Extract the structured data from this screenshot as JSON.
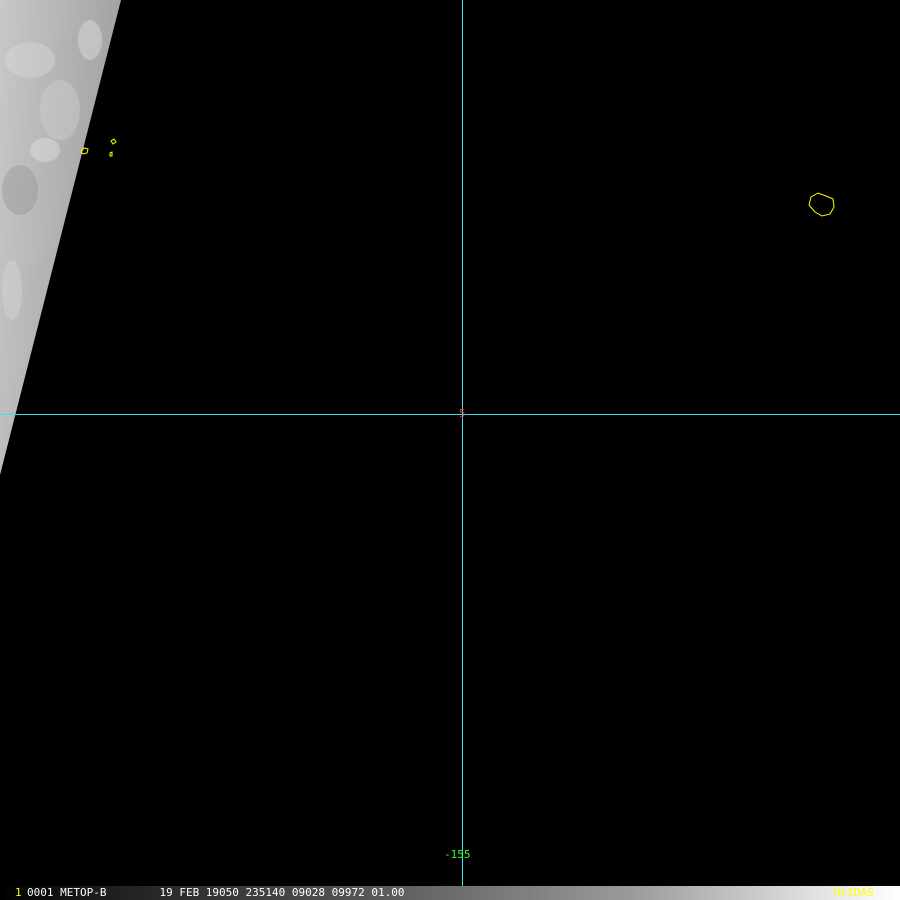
{
  "grid": {
    "lat_label": "5",
    "lon_label": "-155",
    "line_color": "#40e0e0"
  },
  "status_bar": {
    "frame_number": "1",
    "info": "0001 METOP-B        19 FEB 19050 235140 09028 09972 01.00",
    "logo": "McIDAS"
  },
  "colors": {
    "coastline": "#ffff00",
    "latitude_label": "#ff3030",
    "longitude_label": "#30ff30",
    "background": "#000000"
  }
}
